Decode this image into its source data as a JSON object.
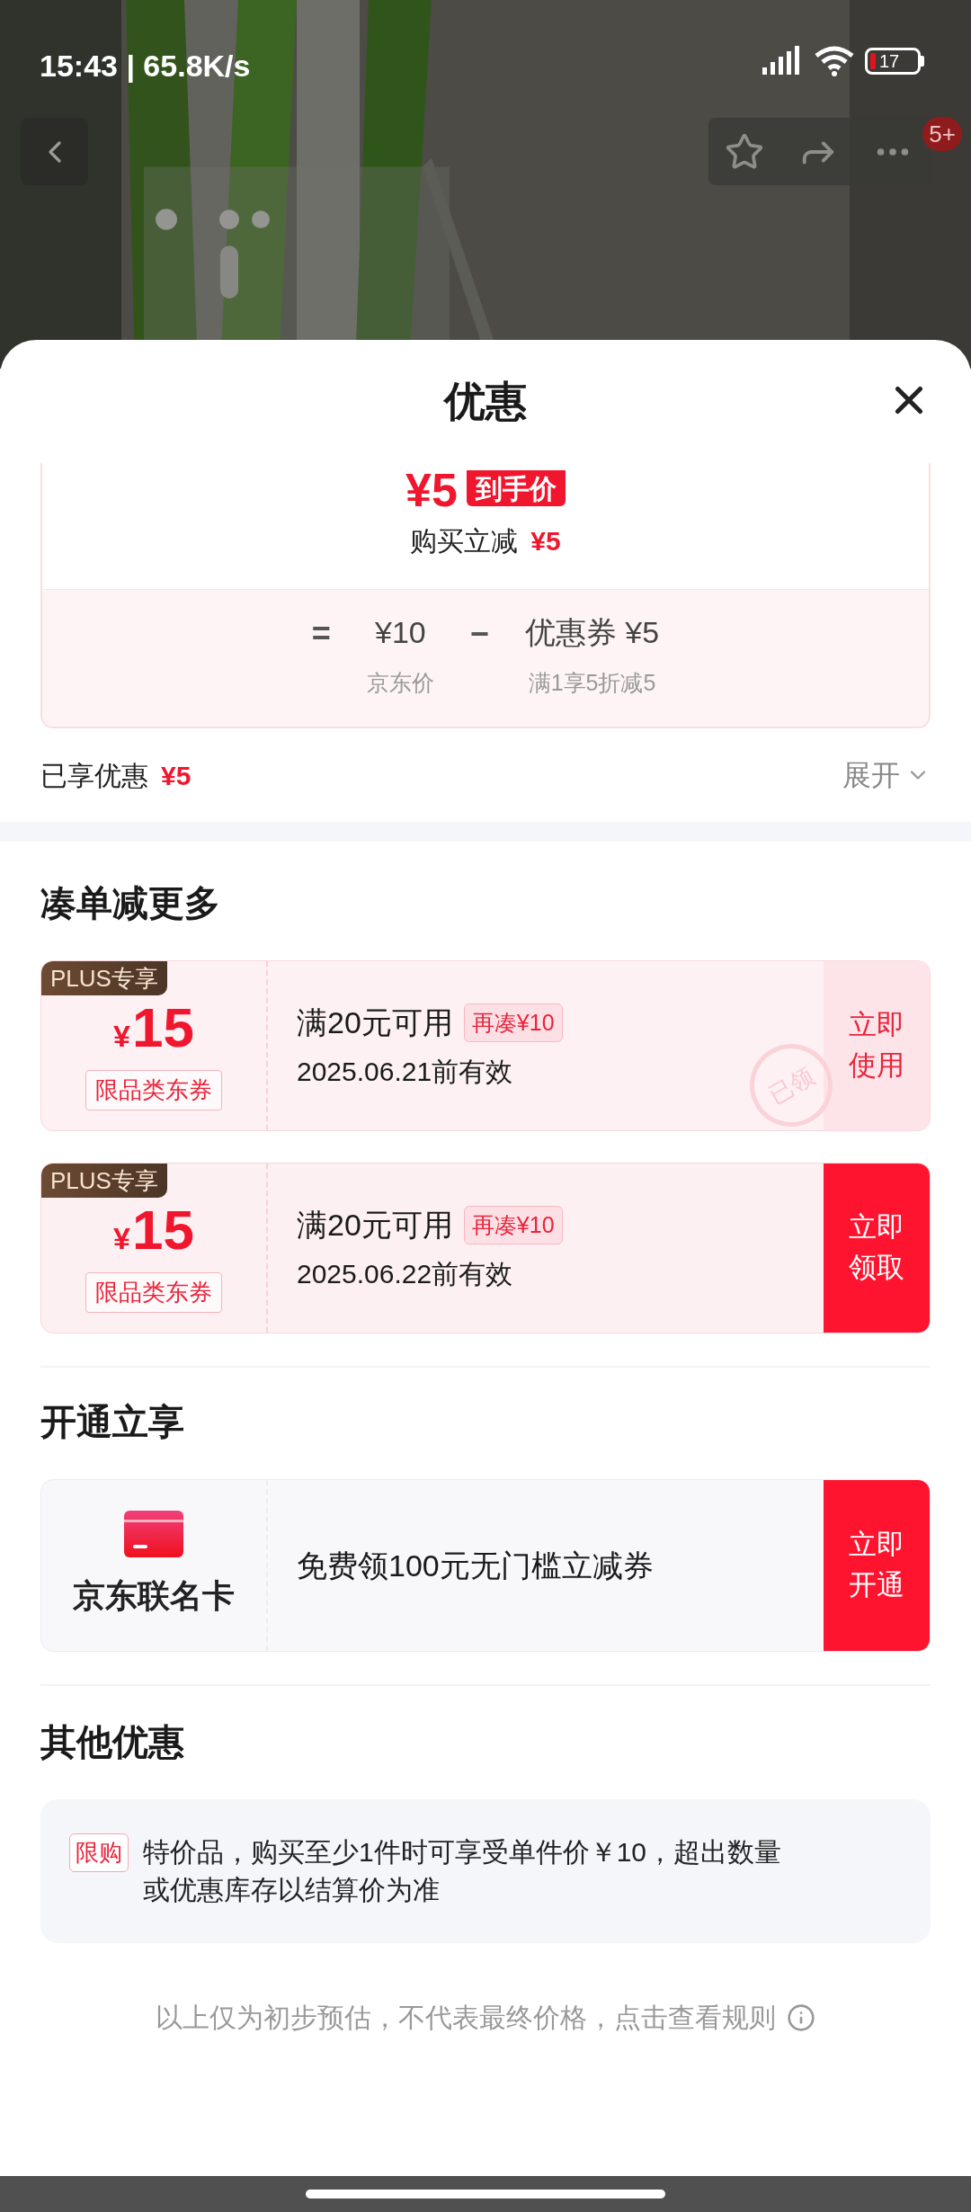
{
  "status_bar": {
    "time": "15:43 | 65.8K/s",
    "battery": "17"
  },
  "nav": {
    "badge": "5+"
  },
  "sheet": {
    "title": "优惠"
  },
  "price_card": {
    "final_price": "¥5",
    "final_tag": "到手价",
    "saving_label": "购买立减",
    "saving_amount": "¥5",
    "equals": "=",
    "base_price": "¥10",
    "base_label": "京东价",
    "minus": "−",
    "coupon_price": "优惠券 ¥5",
    "coupon_label": "满1享5折减5"
  },
  "summary": {
    "label": "已享优惠",
    "amount": "¥5",
    "expand": "展开",
    "expanded": false
  },
  "bundle": {
    "title": "凑单减更多",
    "coupons": [
      {
        "badge": "PLUS专享",
        "currency": "¥",
        "amount": "15",
        "type": "限品类东券",
        "condition": "满20元可用",
        "tag": "再凑¥10",
        "validity": "2025.06.21前有效",
        "action": "立即使用",
        "claimed": true,
        "stamp": "已领"
      },
      {
        "badge": "PLUS专享",
        "currency": "¥",
        "amount": "15",
        "type": "限品类东券",
        "condition": "满20元可用",
        "tag": "再凑¥10",
        "validity": "2025.06.22前有效",
        "action": "立即领取",
        "claimed": false
      }
    ]
  },
  "membership": {
    "title": "开通立享",
    "card_name": "京东联名卡",
    "offer": "免费领100元无门槛立减券",
    "action": "立即开通"
  },
  "other": {
    "title": "其他优惠",
    "tag": "限购",
    "text": "特价品，购买至少1件时可享受单件价￥10，超出数量或优惠库存以结算价为准"
  },
  "footer": {
    "text": "以上仅为初步预估，不代表最终价格，点击查看规则"
  }
}
